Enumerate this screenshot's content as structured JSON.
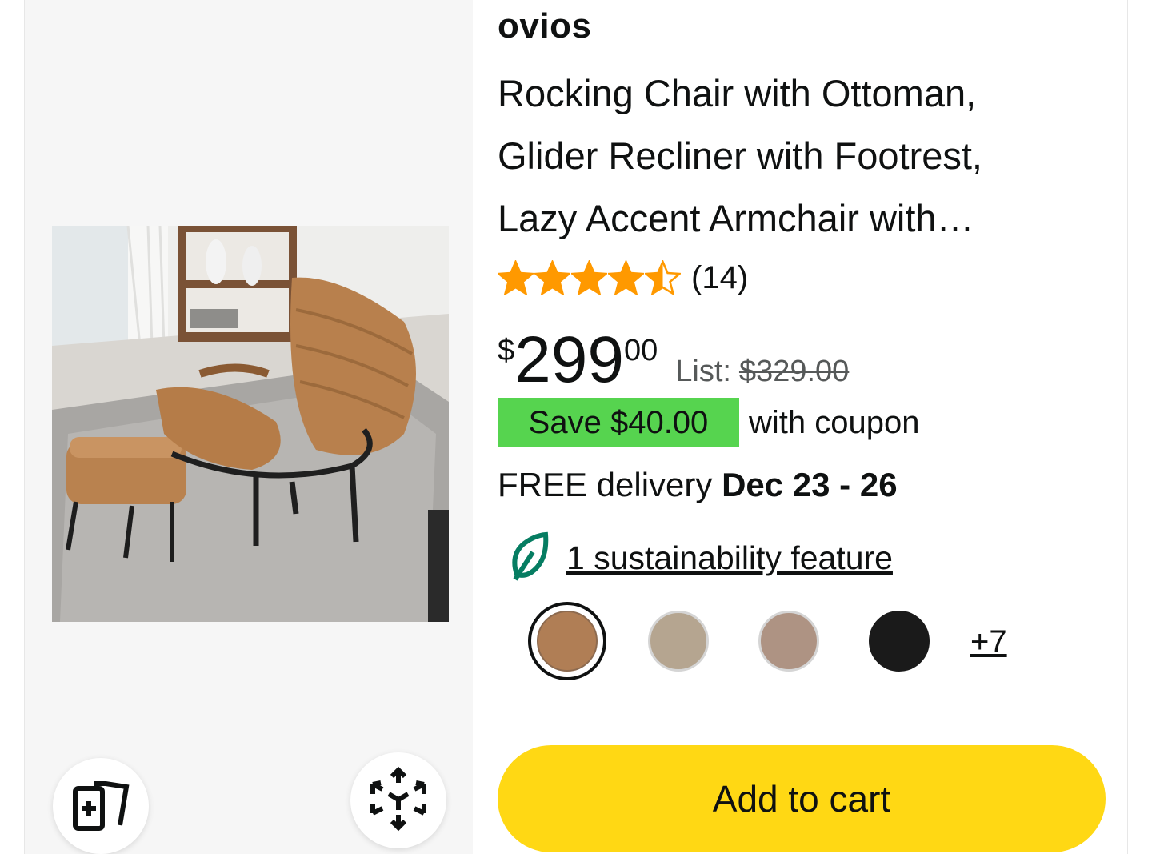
{
  "product": {
    "brand": "ovios",
    "title_lines": [
      "Rocking Chair with Ottoman,",
      "Glider Recliner with Footrest,",
      "Lazy Accent Armchair with…"
    ],
    "rating": 4.5,
    "review_count": "(14)",
    "price": {
      "symbol": "$",
      "whole": "299",
      "fraction": "00",
      "list_label": "List:",
      "list_price": "$329.00"
    },
    "coupon": {
      "badge": "Save $40.00",
      "text": "with coupon"
    },
    "delivery": {
      "prefix": "FREE delivery",
      "dates": "Dec 23 - 26"
    },
    "sustainability": {
      "link": "1 sustainability feature",
      "icon": "leaf-icon"
    },
    "swatches": [
      {
        "name": "brown",
        "color": "#b07e55",
        "selected": true
      },
      {
        "name": "beige",
        "color": "#b5a590",
        "selected": false
      },
      {
        "name": "taupe",
        "color": "#ae9383",
        "selected": false
      },
      {
        "name": "black",
        "color": "#1a1a1a",
        "selected": false
      }
    ],
    "more_swatches": "+7",
    "add_to_cart": "Add to cart"
  },
  "image_actions": {
    "left_icon": "add-to-deck-icon",
    "right_icon": "view-in-3d-icon"
  },
  "colors": {
    "star": "#ff9900",
    "coupon_green": "#56d44f",
    "cart_yellow": "#ffd814",
    "leaf_green": "#067d62"
  }
}
